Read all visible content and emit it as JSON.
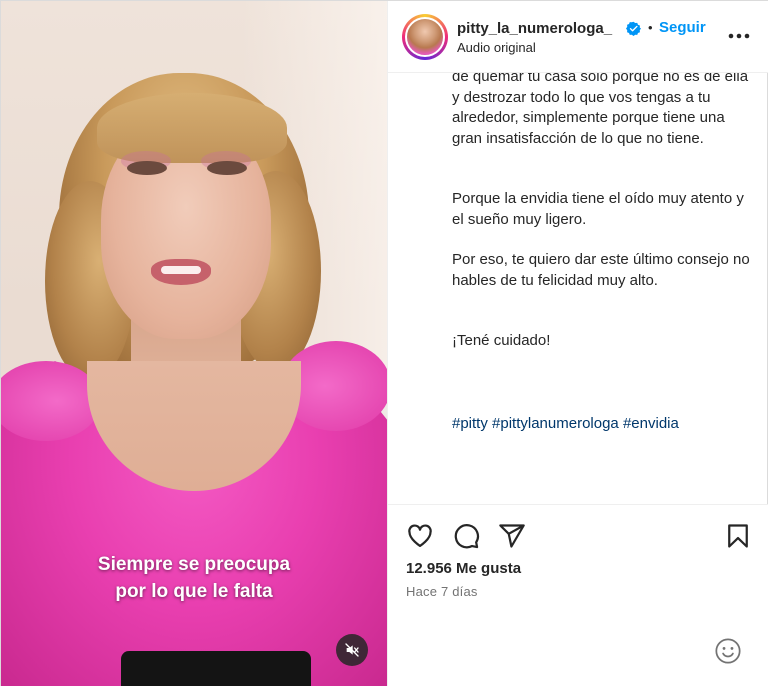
{
  "header": {
    "username": "pitty_la_numerologa_",
    "separator": "•",
    "follow_label": "Seguir",
    "subtitle": "Audio original",
    "verified_icon": "verified-badge-icon",
    "more_icon": "more-options-icon"
  },
  "video": {
    "caption_lines": [
      "Siempre se preocupa",
      "por lo que le falta"
    ],
    "mute_icon": "speaker-muted-icon"
  },
  "post": {
    "paragraphs": [
      "de quemar tu casa solo porque no es de ella y destrozar todo lo que vos tengas a tu alrededor, simplemente porque tiene una gran insatisfacción de lo que no tiene.",
      "Porque la envidia tiene el oído muy atento y el sueño muy ligero.",
      "Por eso, te quiero dar este último consejo no hables de tu felicidad muy alto.",
      "¡Tené cuidado!"
    ],
    "hashtags": [
      "#pitty",
      "#pittylanumerologa",
      "#envidia"
    ]
  },
  "actions": {
    "icons": [
      "heart-icon",
      "comment-icon",
      "share-icon",
      "bookmark-icon"
    ],
    "likes": "12.956 Me gusta",
    "timestamp": "Hace 7 días",
    "emoji_icon": "emoji-icon"
  },
  "colors": {
    "follow": "#0095f6",
    "hashtag": "#00376b",
    "muted_text": "#737373",
    "shirt": "#e93fb0"
  }
}
